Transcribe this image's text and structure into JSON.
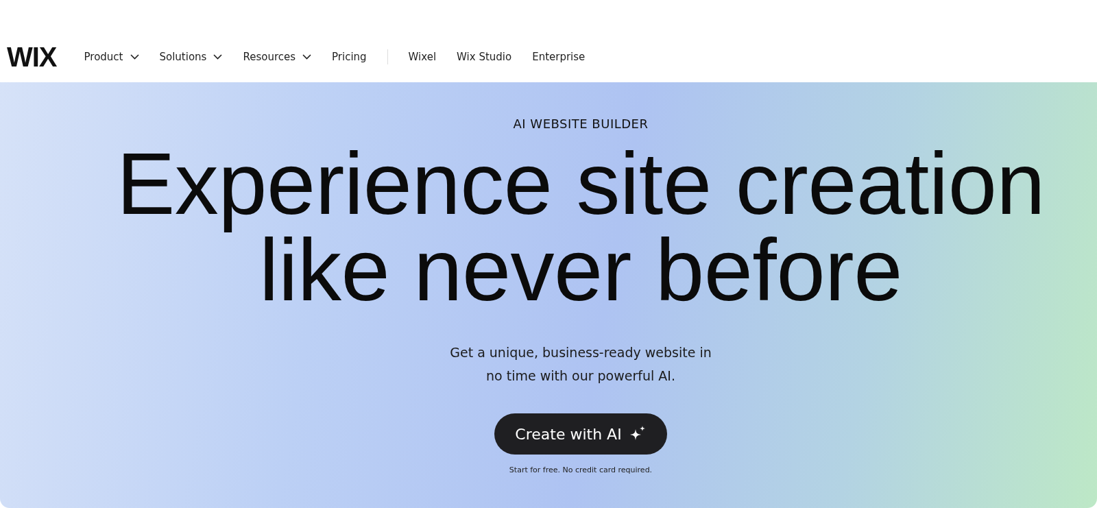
{
  "logo": "WIX",
  "nav": [
    {
      "label": "Product",
      "dropdown": true
    },
    {
      "label": "Solutions",
      "dropdown": true
    },
    {
      "label": "Resources",
      "dropdown": true
    },
    {
      "label": "Pricing",
      "dropdown": false
    }
  ],
  "nav_secondary": [
    "Wixel",
    "Wix Studio",
    "Enterprise"
  ],
  "hero": {
    "eyebrow": "AI WEBSITE BUILDER",
    "headline": [
      "Experience site creation",
      "like never before"
    ],
    "subtitle": [
      "Get a unique, business-ready website in",
      "no time with our powerful AI."
    ],
    "cta": "Create with AI",
    "note": "Start for free. No credit card required."
  }
}
